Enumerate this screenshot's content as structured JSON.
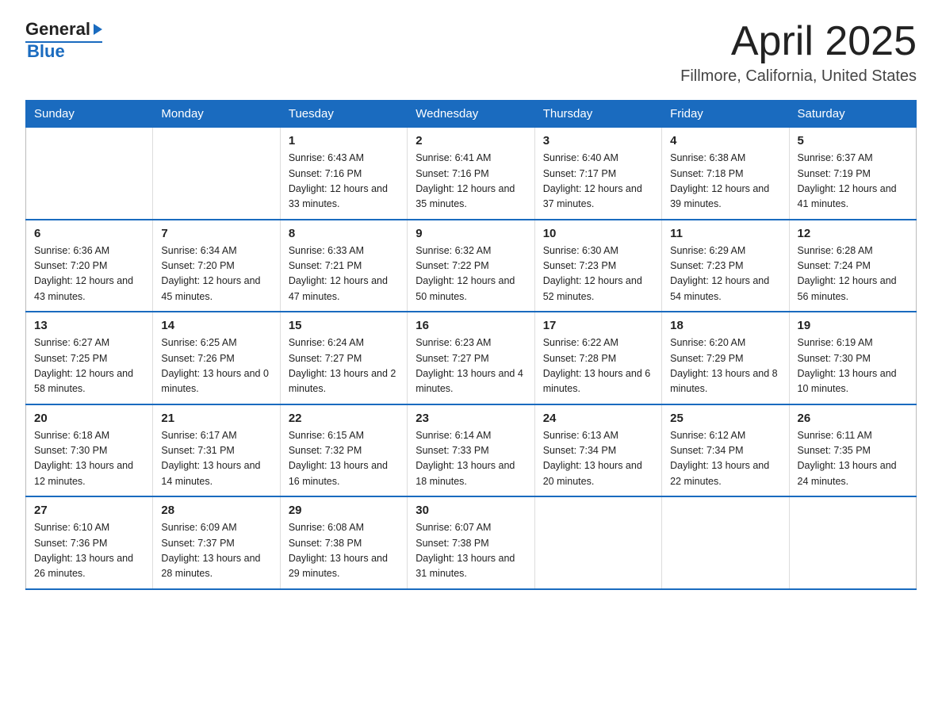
{
  "header": {
    "month": "April 2025",
    "location": "Fillmore, California, United States",
    "logo_general": "General",
    "logo_blue": "Blue"
  },
  "days_of_week": [
    "Sunday",
    "Monday",
    "Tuesday",
    "Wednesday",
    "Thursday",
    "Friday",
    "Saturday"
  ],
  "weeks": [
    [
      {
        "day": "",
        "sunrise": "",
        "sunset": "",
        "daylight": ""
      },
      {
        "day": "",
        "sunrise": "",
        "sunset": "",
        "daylight": ""
      },
      {
        "day": "1",
        "sunrise": "Sunrise: 6:43 AM",
        "sunset": "Sunset: 7:16 PM",
        "daylight": "Daylight: 12 hours and 33 minutes."
      },
      {
        "day": "2",
        "sunrise": "Sunrise: 6:41 AM",
        "sunset": "Sunset: 7:16 PM",
        "daylight": "Daylight: 12 hours and 35 minutes."
      },
      {
        "day": "3",
        "sunrise": "Sunrise: 6:40 AM",
        "sunset": "Sunset: 7:17 PM",
        "daylight": "Daylight: 12 hours and 37 minutes."
      },
      {
        "day": "4",
        "sunrise": "Sunrise: 6:38 AM",
        "sunset": "Sunset: 7:18 PM",
        "daylight": "Daylight: 12 hours and 39 minutes."
      },
      {
        "day": "5",
        "sunrise": "Sunrise: 6:37 AM",
        "sunset": "Sunset: 7:19 PM",
        "daylight": "Daylight: 12 hours and 41 minutes."
      }
    ],
    [
      {
        "day": "6",
        "sunrise": "Sunrise: 6:36 AM",
        "sunset": "Sunset: 7:20 PM",
        "daylight": "Daylight: 12 hours and 43 minutes."
      },
      {
        "day": "7",
        "sunrise": "Sunrise: 6:34 AM",
        "sunset": "Sunset: 7:20 PM",
        "daylight": "Daylight: 12 hours and 45 minutes."
      },
      {
        "day": "8",
        "sunrise": "Sunrise: 6:33 AM",
        "sunset": "Sunset: 7:21 PM",
        "daylight": "Daylight: 12 hours and 47 minutes."
      },
      {
        "day": "9",
        "sunrise": "Sunrise: 6:32 AM",
        "sunset": "Sunset: 7:22 PM",
        "daylight": "Daylight: 12 hours and 50 minutes."
      },
      {
        "day": "10",
        "sunrise": "Sunrise: 6:30 AM",
        "sunset": "Sunset: 7:23 PM",
        "daylight": "Daylight: 12 hours and 52 minutes."
      },
      {
        "day": "11",
        "sunrise": "Sunrise: 6:29 AM",
        "sunset": "Sunset: 7:23 PM",
        "daylight": "Daylight: 12 hours and 54 minutes."
      },
      {
        "day": "12",
        "sunrise": "Sunrise: 6:28 AM",
        "sunset": "Sunset: 7:24 PM",
        "daylight": "Daylight: 12 hours and 56 minutes."
      }
    ],
    [
      {
        "day": "13",
        "sunrise": "Sunrise: 6:27 AM",
        "sunset": "Sunset: 7:25 PM",
        "daylight": "Daylight: 12 hours and 58 minutes."
      },
      {
        "day": "14",
        "sunrise": "Sunrise: 6:25 AM",
        "sunset": "Sunset: 7:26 PM",
        "daylight": "Daylight: 13 hours and 0 minutes."
      },
      {
        "day": "15",
        "sunrise": "Sunrise: 6:24 AM",
        "sunset": "Sunset: 7:27 PM",
        "daylight": "Daylight: 13 hours and 2 minutes."
      },
      {
        "day": "16",
        "sunrise": "Sunrise: 6:23 AM",
        "sunset": "Sunset: 7:27 PM",
        "daylight": "Daylight: 13 hours and 4 minutes."
      },
      {
        "day": "17",
        "sunrise": "Sunrise: 6:22 AM",
        "sunset": "Sunset: 7:28 PM",
        "daylight": "Daylight: 13 hours and 6 minutes."
      },
      {
        "day": "18",
        "sunrise": "Sunrise: 6:20 AM",
        "sunset": "Sunset: 7:29 PM",
        "daylight": "Daylight: 13 hours and 8 minutes."
      },
      {
        "day": "19",
        "sunrise": "Sunrise: 6:19 AM",
        "sunset": "Sunset: 7:30 PM",
        "daylight": "Daylight: 13 hours and 10 minutes."
      }
    ],
    [
      {
        "day": "20",
        "sunrise": "Sunrise: 6:18 AM",
        "sunset": "Sunset: 7:30 PM",
        "daylight": "Daylight: 13 hours and 12 minutes."
      },
      {
        "day": "21",
        "sunrise": "Sunrise: 6:17 AM",
        "sunset": "Sunset: 7:31 PM",
        "daylight": "Daylight: 13 hours and 14 minutes."
      },
      {
        "day": "22",
        "sunrise": "Sunrise: 6:15 AM",
        "sunset": "Sunset: 7:32 PM",
        "daylight": "Daylight: 13 hours and 16 minutes."
      },
      {
        "day": "23",
        "sunrise": "Sunrise: 6:14 AM",
        "sunset": "Sunset: 7:33 PM",
        "daylight": "Daylight: 13 hours and 18 minutes."
      },
      {
        "day": "24",
        "sunrise": "Sunrise: 6:13 AM",
        "sunset": "Sunset: 7:34 PM",
        "daylight": "Daylight: 13 hours and 20 minutes."
      },
      {
        "day": "25",
        "sunrise": "Sunrise: 6:12 AM",
        "sunset": "Sunset: 7:34 PM",
        "daylight": "Daylight: 13 hours and 22 minutes."
      },
      {
        "day": "26",
        "sunrise": "Sunrise: 6:11 AM",
        "sunset": "Sunset: 7:35 PM",
        "daylight": "Daylight: 13 hours and 24 minutes."
      }
    ],
    [
      {
        "day": "27",
        "sunrise": "Sunrise: 6:10 AM",
        "sunset": "Sunset: 7:36 PM",
        "daylight": "Daylight: 13 hours and 26 minutes."
      },
      {
        "day": "28",
        "sunrise": "Sunrise: 6:09 AM",
        "sunset": "Sunset: 7:37 PM",
        "daylight": "Daylight: 13 hours and 28 minutes."
      },
      {
        "day": "29",
        "sunrise": "Sunrise: 6:08 AM",
        "sunset": "Sunset: 7:38 PM",
        "daylight": "Daylight: 13 hours and 29 minutes."
      },
      {
        "day": "30",
        "sunrise": "Sunrise: 6:07 AM",
        "sunset": "Sunset: 7:38 PM",
        "daylight": "Daylight: 13 hours and 31 minutes."
      },
      {
        "day": "",
        "sunrise": "",
        "sunset": "",
        "daylight": ""
      },
      {
        "day": "",
        "sunrise": "",
        "sunset": "",
        "daylight": ""
      },
      {
        "day": "",
        "sunrise": "",
        "sunset": "",
        "daylight": ""
      }
    ]
  ]
}
